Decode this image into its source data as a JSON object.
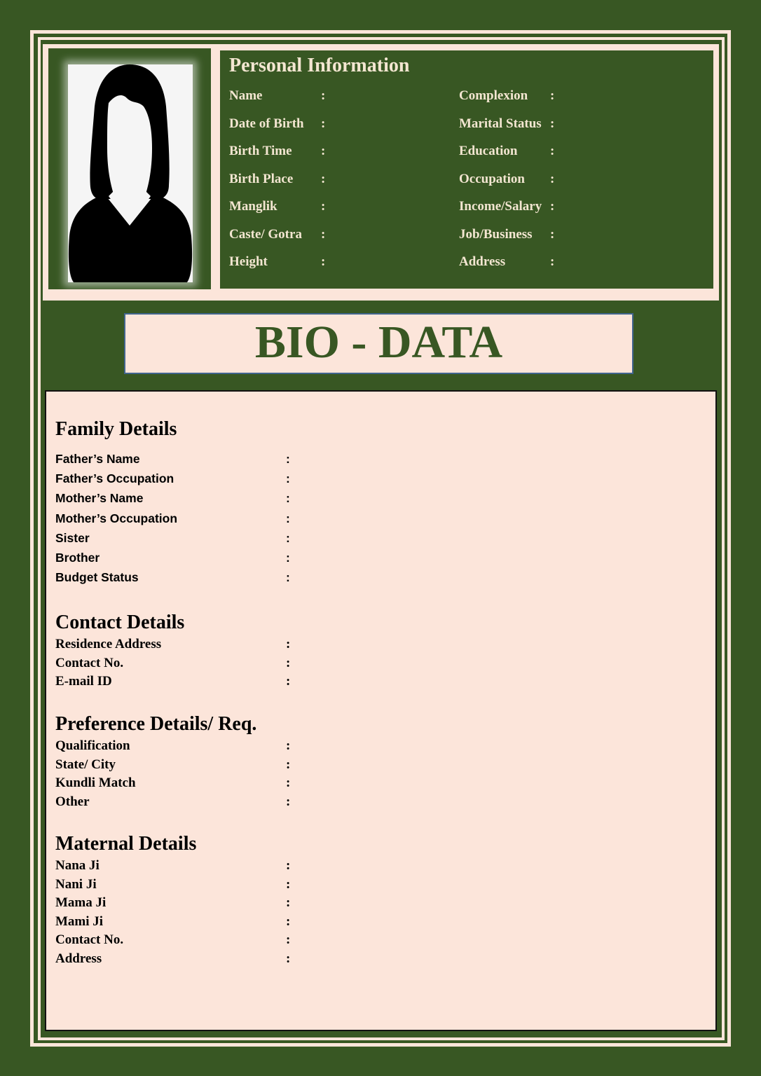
{
  "colors": {
    "green": "#385723",
    "peach": "#fce5da",
    "info_text": "#f3e6d1",
    "title_border": "#41658f"
  },
  "photo": {
    "icon": "female-avatar-silhouette"
  },
  "personal_info": {
    "title": "Personal Information",
    "left": [
      {
        "label": "Name",
        "value": ""
      },
      {
        "label": "Date of Birth",
        "value": ""
      },
      {
        "label": "Birth Time",
        "value": ""
      },
      {
        "label": "Birth Place",
        "value": ""
      },
      {
        "label": "Manglik",
        "value": ""
      },
      {
        "label": "Caste/ Gotra",
        "value": ""
      },
      {
        "label": "Height",
        "value": ""
      }
    ],
    "right": [
      {
        "label": "Complexion",
        "value": ""
      },
      {
        "label": "Marital Status",
        "value": ""
      },
      {
        "label": "Education",
        "value": ""
      },
      {
        "label": "Occupation",
        "value": ""
      },
      {
        "label": "Income/Salary",
        "value": ""
      },
      {
        "label": "Job/Business",
        "value": ""
      },
      {
        "label": "Address",
        "value": ""
      }
    ],
    "separator": ":"
  },
  "heading": "BIO - DATA",
  "sections": {
    "family": {
      "title": "Family Details",
      "items": [
        "Father’s Name",
        "Father’s Occupation",
        "Mother’s Name",
        "Mother’s Occupation",
        "Sister",
        "Brother",
        "Budget Status"
      ]
    },
    "contact": {
      "title": "Contact Details",
      "items": [
        "Residence Address",
        "Contact No.",
        "E-mail ID"
      ]
    },
    "preference": {
      "title": "Preference Details/ Req.",
      "items": [
        "Qualification",
        "State/ City",
        "Kundli Match",
        "Other"
      ]
    },
    "maternal": {
      "title": "Maternal Details",
      "items": [
        "Nana Ji",
        "Nani Ji",
        "Mama Ji",
        "Mami Ji",
        "Contact No.",
        "Address"
      ]
    }
  }
}
